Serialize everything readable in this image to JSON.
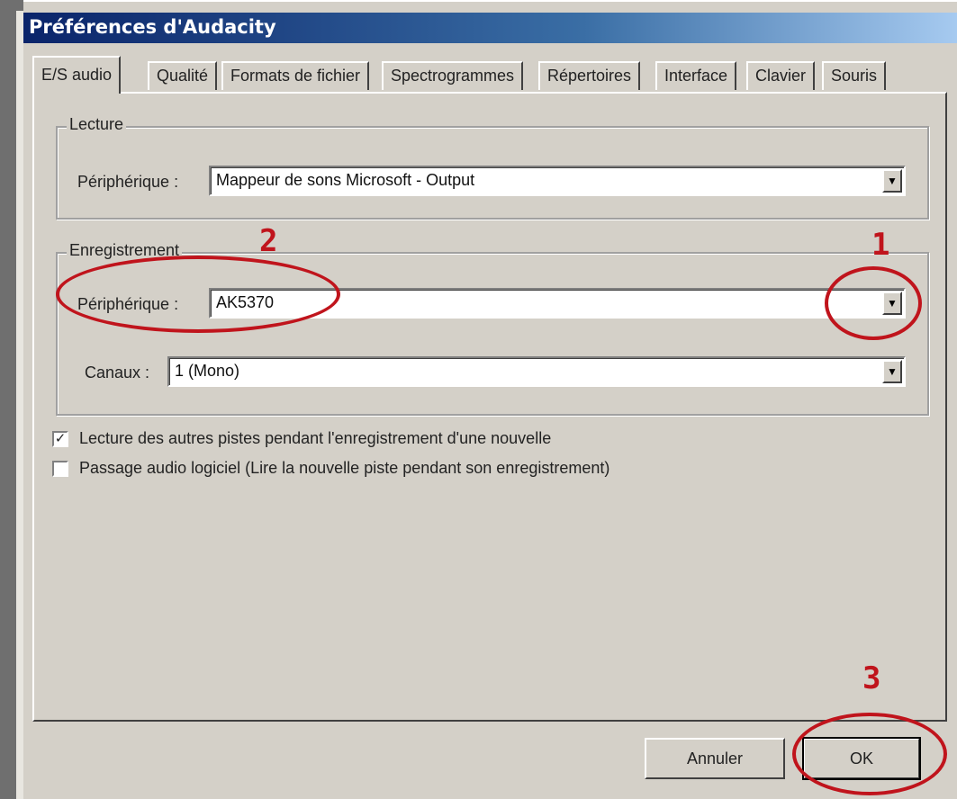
{
  "window": {
    "title": "Préférences d'Audacity"
  },
  "tabs": [
    {
      "label": "E/S audio",
      "active": true
    },
    {
      "label": "Qualité"
    },
    {
      "label": "Formats de fichier"
    },
    {
      "label": "Spectrogrammes"
    },
    {
      "label": "Répertoires"
    },
    {
      "label": "Interface"
    },
    {
      "label": "Clavier"
    },
    {
      "label": "Souris"
    }
  ],
  "playback": {
    "group_label": "Lecture",
    "device_label": "Périphérique :",
    "device_value": "Mappeur de sons Microsoft - Output"
  },
  "recording": {
    "group_label": "Enregistrement",
    "device_label": "Périphérique :",
    "device_value": "AK5370",
    "channels_label": "Canaux :",
    "channels_value": "1 (Mono)"
  },
  "options": [
    {
      "label": "Lecture des autres pistes pendant l'enregistrement d'une nouvelle",
      "checked": true
    },
    {
      "label": "Passage audio logiciel (Lire la nouvelle piste pendant son enregistrement)",
      "checked": false
    }
  ],
  "buttons": {
    "cancel": "Annuler",
    "ok": "OK"
  },
  "annotations": {
    "n1": "1",
    "n2": "2",
    "n3": "3",
    "color": "#c0141c"
  },
  "icons": {
    "dropdown": "chevron-down-icon",
    "check": "checkmark-icon"
  }
}
